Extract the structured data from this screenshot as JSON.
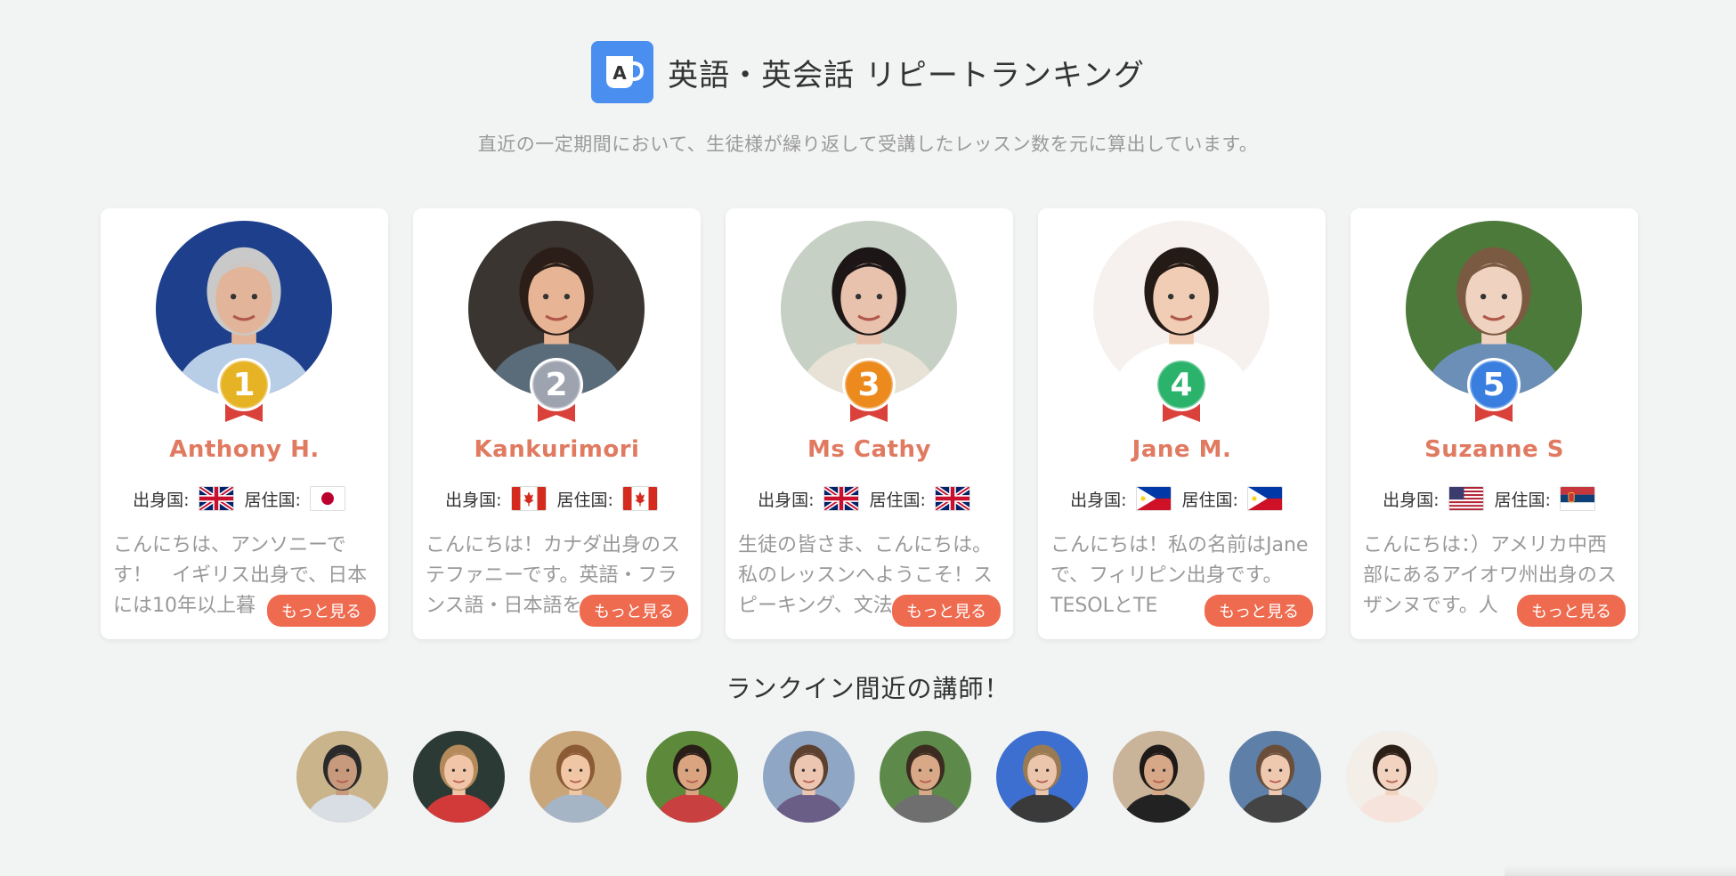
{
  "header": {
    "logo_letter": "A",
    "title": "英語・英会話 リピートランキング",
    "subtitle": "直近の一定期間において、生徒様が繰り返して受講したレッスン数を元に算出しています。"
  },
  "labels": {
    "origin": "出身国:",
    "residence": "居住国:",
    "more": "もっと見る"
  },
  "ranking": [
    {
      "rank": "1",
      "name": "Anthony H.",
      "origin_flag": "uk-flag",
      "residence_flag": "japan-flag",
      "intro": "こんにちは、アンソニーです！　イギリス出身で、日本には10年以上暮"
    },
    {
      "rank": "2",
      "name": "Kankurimori",
      "origin_flag": "canada-flag",
      "residence_flag": "canada-flag",
      "intro": "こんにちは！カナダ出身のステファニーです。英語・フランス語・日本語を"
    },
    {
      "rank": "3",
      "name": "Ms Cathy",
      "origin_flag": "uk-flag",
      "residence_flag": "uk-flag",
      "intro": "生徒の皆さま、こんにちは。私のレッスンへようこそ！スピーキング、文法"
    },
    {
      "rank": "4",
      "name": "Jane M.",
      "origin_flag": "philippines-flag",
      "residence_flag": "philippines-flag",
      "intro": "こんにちは！私の名前はJaneで、フィリピン出身です。TESOLとTE"
    },
    {
      "rank": "5",
      "name": "Suzanne S",
      "origin_flag": "usa-flag",
      "residence_flag": "serbia-flag",
      "intro": "こんにちは：）アメリカ中西部にあるアイオワ州出身のスザンヌです。人"
    }
  ],
  "badge_colors": [
    "#e6b325",
    "#9ea3b0",
    "#ec8a1e",
    "#2cb36b",
    "#3a7fe0"
  ],
  "accent_color": "#ee6b50",
  "name_color": "#e07a60",
  "near_section_title": "ランクイン間近の講師！",
  "near_count": 10
}
